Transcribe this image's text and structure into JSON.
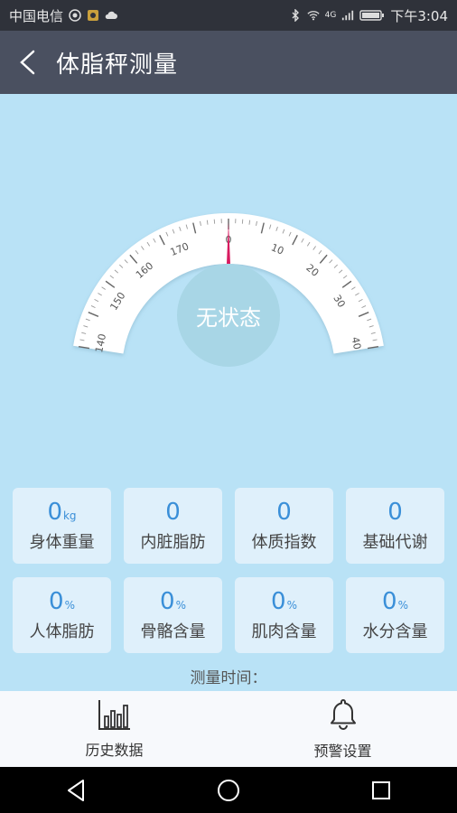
{
  "status_bar": {
    "carrier": "中国电信",
    "network": "4G",
    "time": "下午3:04"
  },
  "header": {
    "title": "体脂秤测量"
  },
  "gauge": {
    "status_text": "无状态",
    "tick_labels": [
      "140",
      "150",
      "160",
      "170",
      "0",
      "10",
      "20",
      "30",
      "40"
    ],
    "needle_color": "#d81b60"
  },
  "metrics": [
    {
      "value": "0",
      "unit": "kg",
      "label": "身体重量"
    },
    {
      "value": "0",
      "unit": "",
      "label": "内脏脂肪"
    },
    {
      "value": "0",
      "unit": "",
      "label": "体质指数"
    },
    {
      "value": "0",
      "unit": "",
      "label": "基础代谢"
    },
    {
      "value": "0",
      "unit": "%",
      "label": "人体脂肪"
    },
    {
      "value": "0",
      "unit": "%",
      "label": "骨骼含量"
    },
    {
      "value": "0",
      "unit": "%",
      "label": "肌肉含量"
    },
    {
      "value": "0",
      "unit": "%",
      "label": "水分含量"
    }
  ],
  "measure_time": {
    "label": "测量时间："
  },
  "bottom_nav": [
    {
      "label": "历史数据",
      "icon": "bar-chart-icon"
    },
    {
      "label": "预警设置",
      "icon": "bell-icon"
    }
  ],
  "colors": {
    "background": "#b9e2f6",
    "app_bar": "#4a5060",
    "accent_value": "#3a8fd8"
  }
}
